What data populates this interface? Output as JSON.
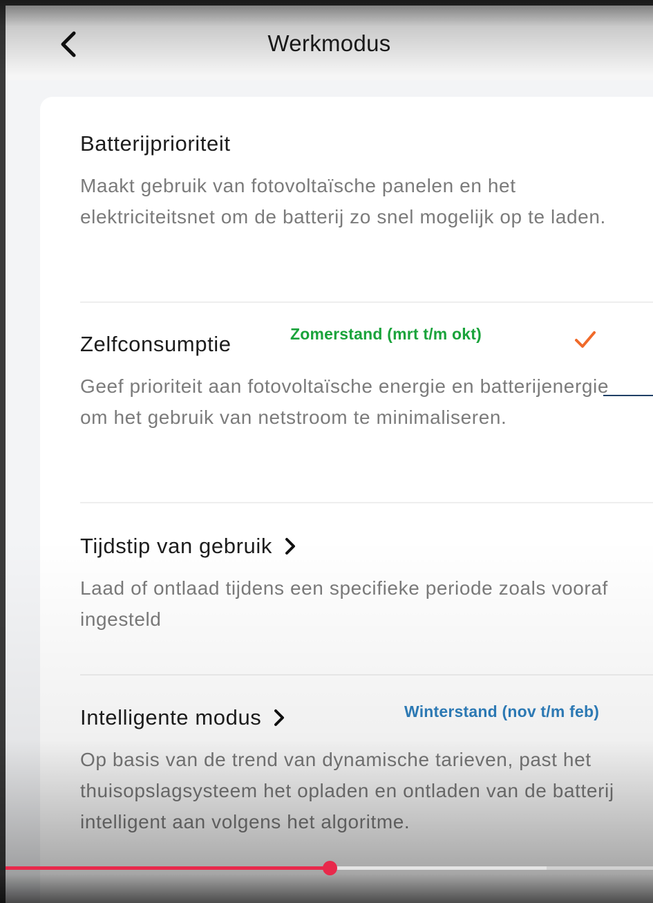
{
  "header": {
    "title": "Werkmodus",
    "back_icon": "chevron-left-icon"
  },
  "options": [
    {
      "title": "Batterijprioriteit",
      "description": "Maakt gebruik van fotovoltaïsche panelen en het elektriciteitsnet om de batterij zo snel mogelijk op te laden.",
      "selected": false,
      "has_chevron": false
    },
    {
      "title": "Zelfconsumptie",
      "description": "Geef prioriteit aan fotovoltaïsche energie en batterijenergie om het gebruik van netstroom te minimaliseren.",
      "selected": true,
      "has_chevron": false,
      "annotation": "Zomerstand (mrt t/m okt)"
    },
    {
      "title": "Tijdstip van gebruik",
      "description": "Laad of ontlaad tijdens een specifieke periode zoals vooraf ingesteld",
      "selected": false,
      "has_chevron": true
    },
    {
      "title": "Intelligente modus",
      "description": "Op basis van de trend van dynamische tarieven, past het thuisopslagsysteem het opladen en ontladen van de batterij intelligent aan volgens het algoritme.",
      "selected": false,
      "has_chevron": true,
      "annotation": "Winterstand (nov t/m feb)"
    }
  ],
  "colors": {
    "check": "#f06a2a",
    "annotation_summer": "#1aa33b",
    "annotation_winter": "#2e7fbd",
    "progress": "#e8294b"
  },
  "video_progress": {
    "played_fraction": 0.5,
    "buffered_fraction": 0.836
  }
}
